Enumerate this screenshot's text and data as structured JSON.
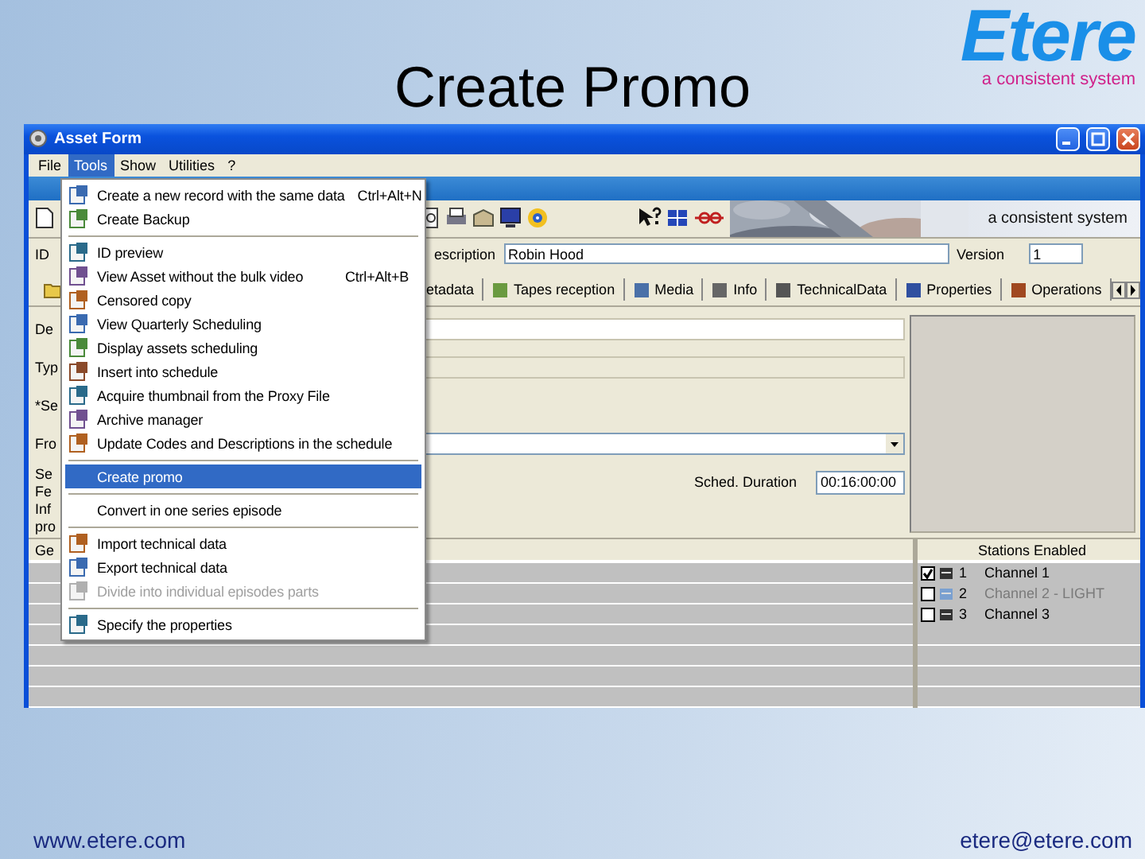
{
  "slide": {
    "title": "Create Promo",
    "logo": "Etere",
    "logo_tagline": "a consistent system",
    "footer_left": "www.etere.com",
    "footer_right": "etere@etere.com"
  },
  "window": {
    "title": "Asset Form"
  },
  "menubar": [
    {
      "label": "File",
      "selected": false
    },
    {
      "label": "Tools",
      "selected": true
    },
    {
      "label": "Show",
      "selected": false
    },
    {
      "label": "Utilities",
      "selected": false
    },
    {
      "label": "?",
      "selected": false
    }
  ],
  "tools_menu": [
    {
      "kind": "item",
      "label": "Create a new record with the same data",
      "shortcut": "Ctrl+Alt+N",
      "icon": true,
      "selected": false,
      "disabled": false
    },
    {
      "kind": "item",
      "label": "Create Backup",
      "icon": true,
      "selected": false,
      "disabled": false
    },
    {
      "kind": "separator"
    },
    {
      "kind": "item",
      "label": "ID preview",
      "icon": true,
      "selected": false,
      "disabled": false
    },
    {
      "kind": "item",
      "label": "View Asset without the bulk video",
      "shortcut": "Ctrl+Alt+B",
      "icon": true,
      "selected": false,
      "disabled": false
    },
    {
      "kind": "item",
      "label": "Censored copy",
      "icon": true,
      "selected": false,
      "disabled": false
    },
    {
      "kind": "item",
      "label": "View Quarterly Scheduling",
      "icon": true,
      "selected": false,
      "disabled": false
    },
    {
      "kind": "item",
      "label": "Display assets scheduling",
      "icon": true,
      "selected": false,
      "disabled": false
    },
    {
      "kind": "item",
      "label": "Insert into schedule",
      "icon": true,
      "selected": false,
      "disabled": false
    },
    {
      "kind": "item",
      "label": "Acquire thumbnail from the Proxy File",
      "icon": true,
      "selected": false,
      "disabled": false
    },
    {
      "kind": "item",
      "label": "Archive manager",
      "icon": true,
      "selected": false,
      "disabled": false
    },
    {
      "kind": "item",
      "label": "Update Codes and Descriptions in the schedule",
      "icon": true,
      "selected": false,
      "disabled": false
    },
    {
      "kind": "separator"
    },
    {
      "kind": "item",
      "label": "Create promo",
      "icon": false,
      "selected": true,
      "disabled": false
    },
    {
      "kind": "separator"
    },
    {
      "kind": "item",
      "label": "Convert in one series episode",
      "icon": false,
      "selected": false,
      "disabled": false
    },
    {
      "kind": "separator"
    },
    {
      "kind": "item",
      "label": "Import technical data",
      "icon": true,
      "selected": false,
      "disabled": false
    },
    {
      "kind": "item",
      "label": "Export technical data",
      "icon": true,
      "selected": false,
      "disabled": false
    },
    {
      "kind": "item",
      "label": "Divide into individual episodes parts",
      "icon": true,
      "selected": false,
      "disabled": true
    },
    {
      "kind": "separator"
    },
    {
      "kind": "item",
      "label": "Specify the properties",
      "icon": true,
      "selected": false,
      "disabled": false
    }
  ],
  "banner": {
    "tagline": "a consistent system"
  },
  "header_fields": {
    "id_label": "ID",
    "description_label": "escription",
    "description": "Robin Hood",
    "version_label": "Version",
    "version": "1"
  },
  "tabs": [
    {
      "label": "etadata",
      "selected": false
    },
    {
      "label": "Tapes reception",
      "selected": false
    },
    {
      "label": "Media",
      "selected": false
    },
    {
      "label": "Info",
      "selected": false
    },
    {
      "label": "TechnicalData",
      "selected": false
    },
    {
      "label": "Properties",
      "selected": false
    },
    {
      "label": "Operations",
      "selected": false
    }
  ],
  "form": {
    "labels": [
      "De",
      "Typ",
      "*Se",
      "Fro"
    ],
    "notes": [
      "Se",
      "Fe",
      "Inf",
      "pro"
    ],
    "sched_duration_label": "Sched. Duration",
    "sched_duration": "00:16:00:00"
  },
  "grid": {
    "column_1": "Ge",
    "stations_header": "Stations Enabled",
    "stations": [
      {
        "number": "1",
        "name": "Channel 1",
        "checked": true,
        "disabled": false
      },
      {
        "number": "2",
        "name": "Channel 2 - LIGHT",
        "checked": false,
        "disabled": true
      },
      {
        "number": "3",
        "name": "Channel 3",
        "checked": false,
        "disabled": false
      }
    ]
  }
}
